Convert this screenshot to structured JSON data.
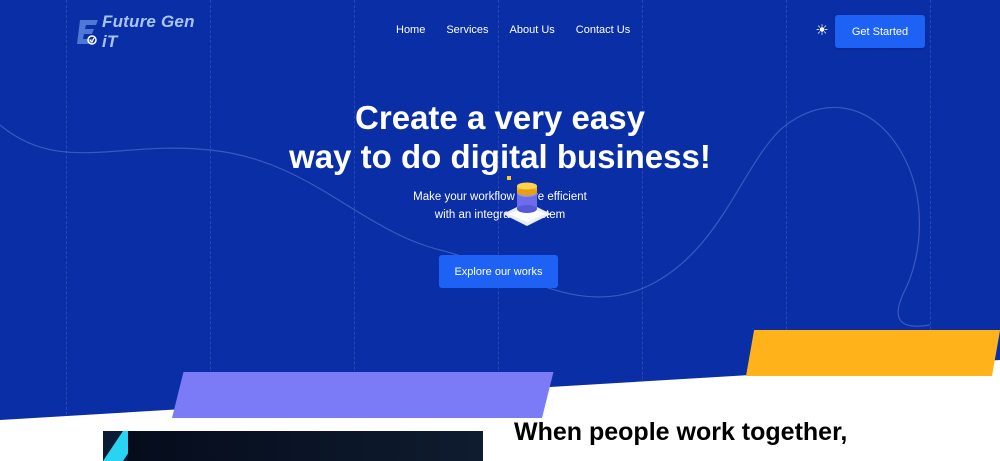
{
  "brand": {
    "name": "Future Gen iT",
    "mark_letter": "E"
  },
  "nav": {
    "items": [
      {
        "label": "Home"
      },
      {
        "label": "Services"
      },
      {
        "label": "About Us"
      },
      {
        "label": "Contact Us"
      }
    ],
    "theme_icon": "sun-icon",
    "cta_label": "Get Started"
  },
  "hero": {
    "headline_line1": "Create a very easy",
    "headline_line2": "way to do digital business!",
    "subtext_line1": "Make your workflow more efficient",
    "subtext_line2": "with an integrated system",
    "button_label": "Explore our works"
  },
  "section": {
    "title": "When people work together,"
  },
  "colors": {
    "hero_bg": "#0a2ea6",
    "primary_button": "#1e62f5",
    "purple_shape": "#7b7bf7",
    "yellow_shape": "#ffb21a",
    "cyan_accent": "#29d3f2",
    "logo_text": "#a7c4f5"
  }
}
